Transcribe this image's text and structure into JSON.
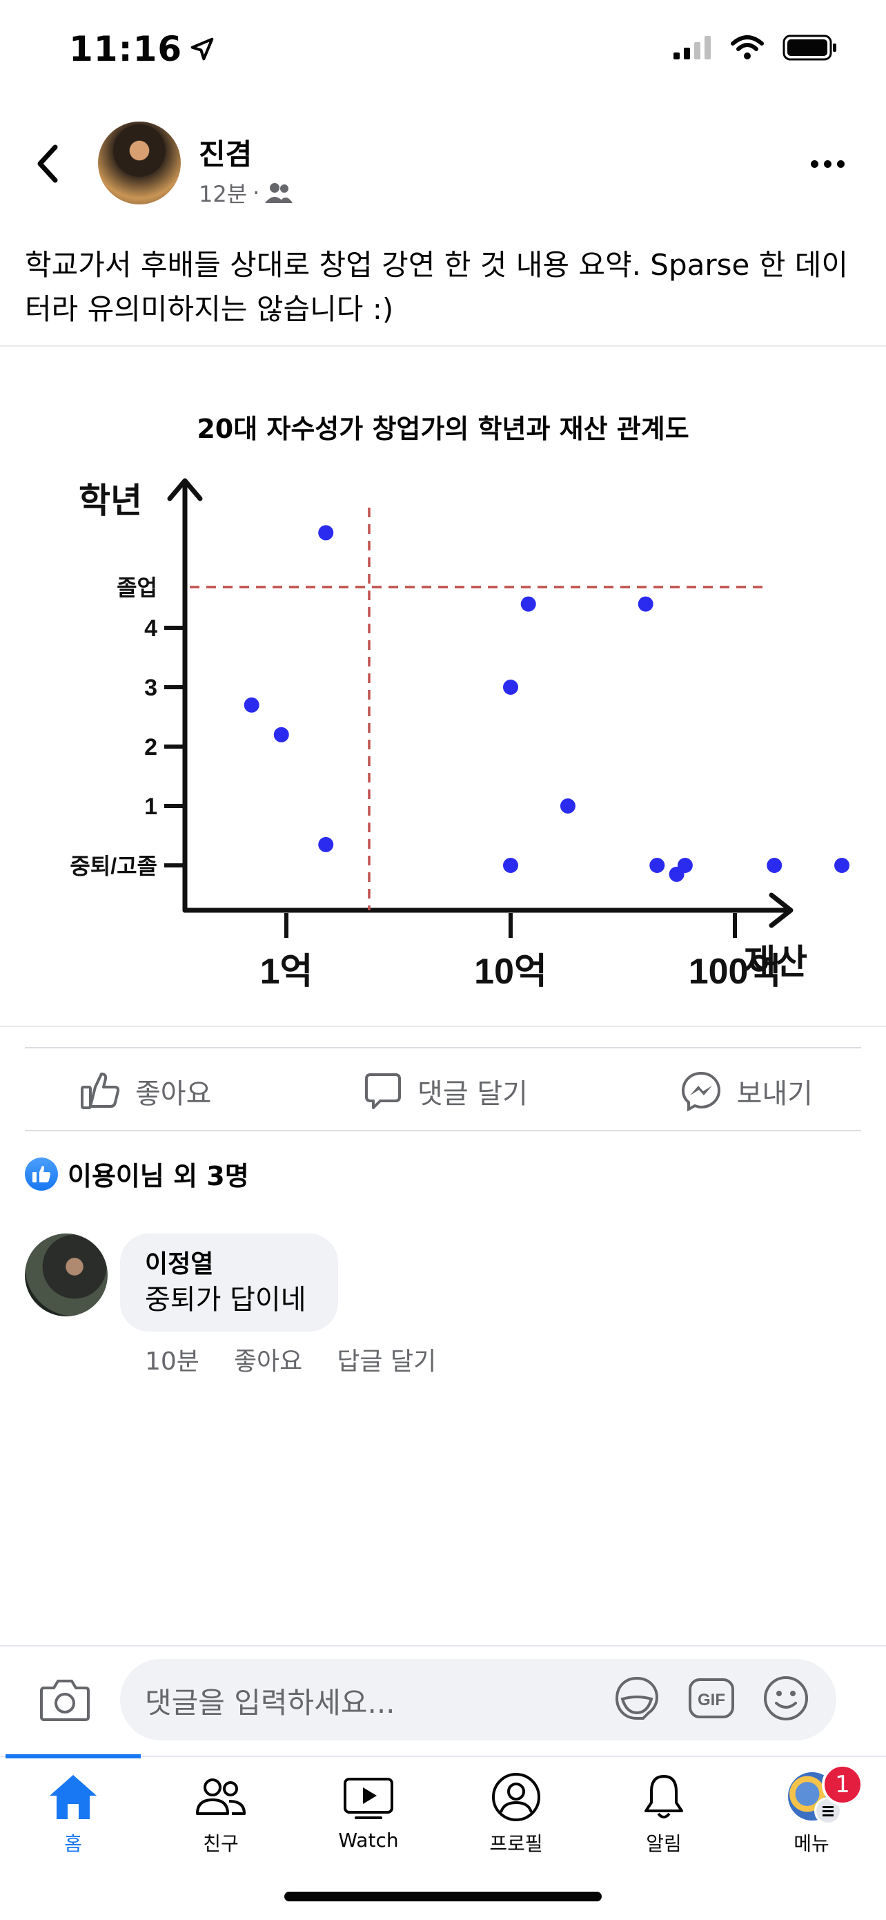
{
  "status_bar": {
    "time": "11:16"
  },
  "post": {
    "author": "진겸",
    "time": "12분",
    "audience_separator": "·",
    "text": "학교가서 후배들 상대로 창업 강연 한 것 내용 요약. Sparse 한 데이터라 유의미하지는 않습니다 :)"
  },
  "chart_data": {
    "type": "scatter",
    "title": "20대 자수성가 창업가의 학년과 재산 관계도",
    "xlabel": "재산",
    "ylabel": "학년",
    "x_scale": "log",
    "x_ticks": [
      "1억",
      "10억",
      "100억"
    ],
    "y_ticks": [
      "중퇴/고졸",
      "1",
      "2",
      "3",
      "4",
      "졸업"
    ],
    "reference_lines": [
      "vertical dashed near 5억",
      "horizontal dashed at 졸업"
    ],
    "points": [
      {
        "x": 0.7,
        "y": 2.7
      },
      {
        "x": 0.95,
        "y": 2.2
      },
      {
        "x": 1.5,
        "y": 5.6
      },
      {
        "x": 1.5,
        "y": 0.35
      },
      {
        "x": 10,
        "y": 3.0
      },
      {
        "x": 10,
        "y": 0.0
      },
      {
        "x": 12,
        "y": 4.4
      },
      {
        "x": 18,
        "y": 1.0
      },
      {
        "x": 40,
        "y": 4.4
      },
      {
        "x": 45,
        "y": 0.0
      },
      {
        "x": 55,
        "y": -0.15
      },
      {
        "x": 60,
        "y": 0.0
      },
      {
        "x": 150,
        "y": 0.0
      },
      {
        "x": 300,
        "y": 0.0
      }
    ],
    "point_color": "#2b2bf0",
    "dashed_color": "#c0504d"
  },
  "actions": {
    "like": "좋아요",
    "comment": "댓글 달기",
    "send": "보내기"
  },
  "reactions": {
    "summary": "이용이님 외 3명"
  },
  "comment": {
    "author": "이정열",
    "text": "중퇴가 답이네",
    "time": "10분",
    "like": "좋아요",
    "reply": "답글 달기"
  },
  "comment_input": {
    "placeholder": "댓글을 입력하세요..."
  },
  "tabbar": {
    "home": "홈",
    "friends": "친구",
    "watch": "Watch",
    "profile": "프로필",
    "notifications": "알림",
    "menu": "메뉴",
    "menu_badge": "1"
  },
  "colors": {
    "accent": "#1877f2",
    "badge": "#e41e3f"
  }
}
